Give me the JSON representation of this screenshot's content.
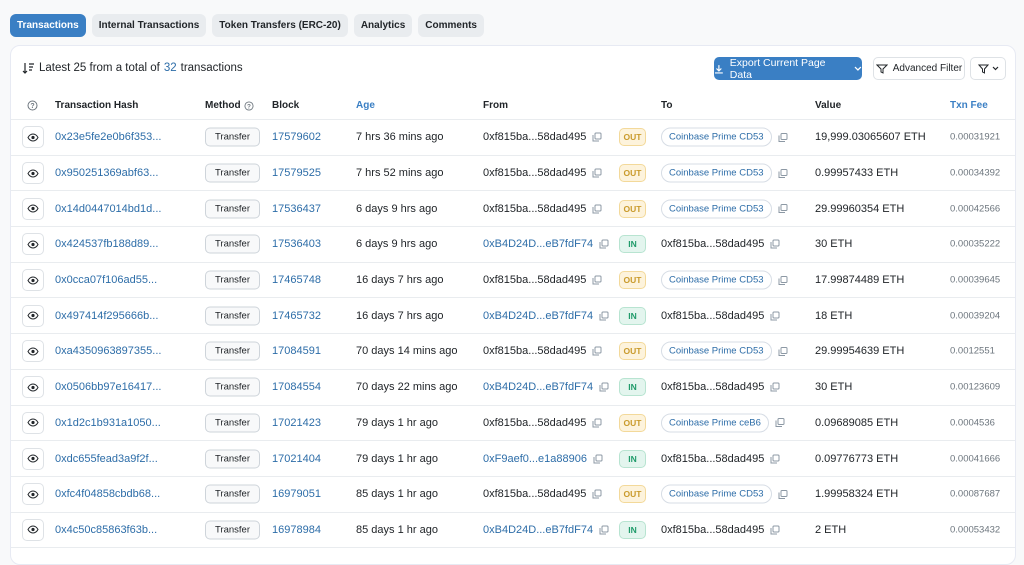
{
  "tabs": [
    {
      "label": "Transactions",
      "active": true
    },
    {
      "label": "Internal Transactions",
      "active": false
    },
    {
      "label": "Token Transfers (ERC-20)",
      "active": false
    },
    {
      "label": "Analytics",
      "active": false
    },
    {
      "label": "Comments",
      "active": false
    }
  ],
  "summary": {
    "prefix": "Latest 25 from a total of",
    "count": "32",
    "suffix": "transactions"
  },
  "toolbar": {
    "export_label": "Export Current Page Data",
    "advanced_filter_label": "Advanced Filter"
  },
  "columns": {
    "hash": "Transaction Hash",
    "method": "Method",
    "block": "Block",
    "age": "Age",
    "from": "From",
    "to": "To",
    "value": "Value",
    "fee": "Txn Fee"
  },
  "colors": {
    "accent": "#3a7fc4",
    "link": "#2d6da8",
    "out": "#c99a2b",
    "in": "#1f9b6a"
  },
  "rows": [
    {
      "hash": "0x23e5fe2e0b6f353...",
      "method": "Transfer",
      "block": "17579602",
      "age": "7 hrs 36 mins ago",
      "from": "0xf815ba...58dad495",
      "from_link": false,
      "dir": "OUT",
      "to": "Coinbase Prime CD53",
      "to_pill": true,
      "value": "19,999.03065607 ETH",
      "fee": "0.00031921"
    },
    {
      "hash": "0x950251369abf63...",
      "method": "Transfer",
      "block": "17579525",
      "age": "7 hrs 52 mins ago",
      "from": "0xf815ba...58dad495",
      "from_link": false,
      "dir": "OUT",
      "to": "Coinbase Prime CD53",
      "to_pill": true,
      "value": "0.99957433 ETH",
      "fee": "0.00034392"
    },
    {
      "hash": "0x14d0447014bd1d...",
      "method": "Transfer",
      "block": "17536437",
      "age": "6 days 9 hrs ago",
      "from": "0xf815ba...58dad495",
      "from_link": false,
      "dir": "OUT",
      "to": "Coinbase Prime CD53",
      "to_pill": true,
      "value": "29.99960354 ETH",
      "fee": "0.00042566"
    },
    {
      "hash": "0x424537fb188d89...",
      "method": "Transfer",
      "block": "17536403",
      "age": "6 days 9 hrs ago",
      "from": "0xB4D24D...eB7fdF74",
      "from_link": true,
      "dir": "IN",
      "to": "0xf815ba...58dad495",
      "to_pill": false,
      "value": "30 ETH",
      "fee": "0.00035222"
    },
    {
      "hash": "0x0cca07f106ad55...",
      "method": "Transfer",
      "block": "17465748",
      "age": "16 days 7 hrs ago",
      "from": "0xf815ba...58dad495",
      "from_link": false,
      "dir": "OUT",
      "to": "Coinbase Prime CD53",
      "to_pill": true,
      "value": "17.99874489 ETH",
      "fee": "0.00039645"
    },
    {
      "hash": "0x497414f295666b...",
      "method": "Transfer",
      "block": "17465732",
      "age": "16 days 7 hrs ago",
      "from": "0xB4D24D...eB7fdF74",
      "from_link": true,
      "dir": "IN",
      "to": "0xf815ba...58dad495",
      "to_pill": false,
      "value": "18 ETH",
      "fee": "0.00039204"
    },
    {
      "hash": "0xa4350963897355...",
      "method": "Transfer",
      "block": "17084591",
      "age": "70 days 14 mins ago",
      "from": "0xf815ba...58dad495",
      "from_link": false,
      "dir": "OUT",
      "to": "Coinbase Prime CD53",
      "to_pill": true,
      "value": "29.99954639 ETH",
      "fee": "0.0012551"
    },
    {
      "hash": "0x0506bb97e16417...",
      "method": "Transfer",
      "block": "17084554",
      "age": "70 days 22 mins ago",
      "from": "0xB4D24D...eB7fdF74",
      "from_link": true,
      "dir": "IN",
      "to": "0xf815ba...58dad495",
      "to_pill": false,
      "value": "30 ETH",
      "fee": "0.00123609"
    },
    {
      "hash": "0x1d2c1b931a1050...",
      "method": "Transfer",
      "block": "17021423",
      "age": "79 days 1 hr ago",
      "from": "0xf815ba...58dad495",
      "from_link": false,
      "dir": "OUT",
      "to": "Coinbase Prime ceB6",
      "to_pill": true,
      "value": "0.09689085 ETH",
      "fee": "0.0004536"
    },
    {
      "hash": "0xdc655fead3a9f2f...",
      "method": "Transfer",
      "block": "17021404",
      "age": "79 days 1 hr ago",
      "from": "0xF9aef0...e1a88906",
      "from_link": true,
      "dir": "IN",
      "to": "0xf815ba...58dad495",
      "to_pill": false,
      "value": "0.09776773 ETH",
      "fee": "0.00041666"
    },
    {
      "hash": "0xfc4f04858cbdb68...",
      "method": "Transfer",
      "block": "16979051",
      "age": "85 days 1 hr ago",
      "from": "0xf815ba...58dad495",
      "from_link": false,
      "dir": "OUT",
      "to": "Coinbase Prime CD53",
      "to_pill": true,
      "value": "1.99958324 ETH",
      "fee": "0.00087687"
    },
    {
      "hash": "0x4c50c85863f63b...",
      "method": "Transfer",
      "block": "16978984",
      "age": "85 days 1 hr ago",
      "from": "0xB4D24D...eB7fdF74",
      "from_link": true,
      "dir": "IN",
      "to": "0xf815ba...58dad495",
      "to_pill": false,
      "value": "2 ETH",
      "fee": "0.00053432"
    }
  ]
}
